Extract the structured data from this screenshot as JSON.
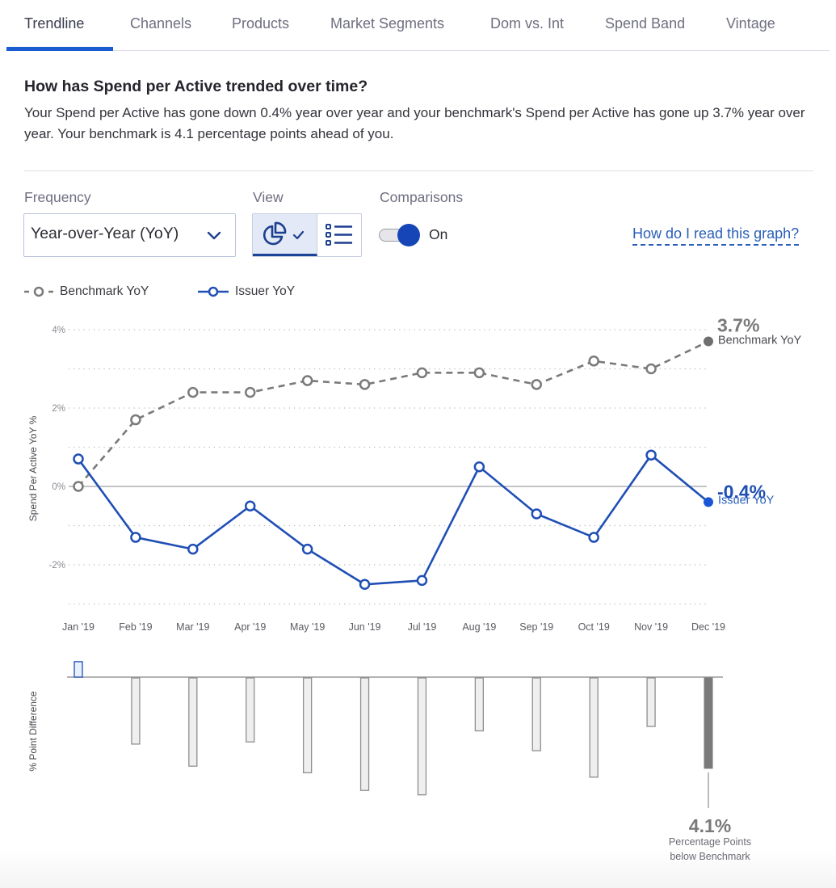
{
  "tabs": [
    {
      "label": "Trendline",
      "active": true
    },
    {
      "label": "Channels",
      "active": false
    },
    {
      "label": "Products",
      "active": false
    },
    {
      "label": "Market Segments",
      "active": false
    },
    {
      "label": "Dom vs. Int",
      "active": false
    },
    {
      "label": "Spend Band",
      "active": false
    },
    {
      "label": "Vintage",
      "active": false
    }
  ],
  "header": {
    "question": "How has Spend per Active trended over time?",
    "summary": "Your Spend per Active has gone down 0.4% year over year and your benchmark's Spend per Active has gone up 3.7% year over year. Your benchmark is 4.1 percentage points ahead of you."
  },
  "controls": {
    "frequency_label": "Frequency",
    "frequency_value": "Year-over-Year (YoY)",
    "view_label": "View",
    "view_options": [
      {
        "name": "chart-view",
        "icon": "pie-chart-icon",
        "selected": true
      },
      {
        "name": "list-view",
        "icon": "list-icon",
        "selected": false
      }
    ],
    "comparisons_label": "Comparisons",
    "comparisons_state": "On",
    "comparisons_on": true,
    "help_link": "How do I read this graph?"
  },
  "colors": {
    "issuer": "#1f4fb5",
    "benchmark": "#7a7a7a",
    "accent": "#1b5dd0"
  },
  "chart_data": [
    {
      "type": "line",
      "title": "",
      "ylabel": "Spend Per Active YoY %",
      "xlabel": "",
      "ylim": [
        -3,
        4
      ],
      "yticks": [
        {
          "value": 4,
          "label": "4%"
        },
        {
          "value": 2,
          "label": "2%"
        },
        {
          "value": 0,
          "label": "0%"
        },
        {
          "value": -2,
          "label": "-2%"
        }
      ],
      "gridlines": [
        4,
        3,
        2,
        1,
        -1,
        -2,
        -3
      ],
      "grid": true,
      "legend_position": "top-left",
      "categories": [
        "Jan '19",
        "Feb '19",
        "Mar '19",
        "Apr '19",
        "May '19",
        "Jun '19",
        "Jul '19",
        "Aug '19",
        "Sep '19",
        "Oct '19",
        "Nov '19",
        "Dec '19"
      ],
      "series": [
        {
          "name": "Benchmark YoY",
          "style": "dashed",
          "values": [
            0.0,
            1.7,
            2.4,
            2.4,
            2.7,
            2.6,
            2.9,
            2.9,
            2.6,
            3.2,
            3.0,
            3.7
          ],
          "end_label_value": "3.7%",
          "end_label_name": "Benchmark YoY"
        },
        {
          "name": "Issuer YoY",
          "style": "solid",
          "values": [
            0.7,
            -1.3,
            -1.6,
            -0.5,
            -1.6,
            -2.5,
            -2.4,
            0.5,
            -0.7,
            -1.3,
            0.8,
            -0.4
          ],
          "end_label_value": "-0.4%",
          "end_label_name": "Issuer YoY"
        }
      ]
    },
    {
      "type": "bar",
      "title": "",
      "ylabel": "% Point Difference",
      "categories": [
        "Jan '19",
        "Feb '19",
        "Mar '19",
        "Apr '19",
        "May '19",
        "Jun '19",
        "Jul '19",
        "Aug '19",
        "Sep '19",
        "Oct '19",
        "Nov '19",
        "Dec '19"
      ],
      "values": [
        0.7,
        -3.0,
        -4.0,
        -2.9,
        -4.3,
        -5.1,
        -5.3,
        -2.4,
        -3.3,
        -4.5,
        -2.2,
        -4.1
      ],
      "ylim": [
        -5.5,
        1
      ],
      "annotation": {
        "value": "4.1%",
        "line1": "Percentage Points",
        "line2": "below Benchmark"
      }
    }
  ]
}
